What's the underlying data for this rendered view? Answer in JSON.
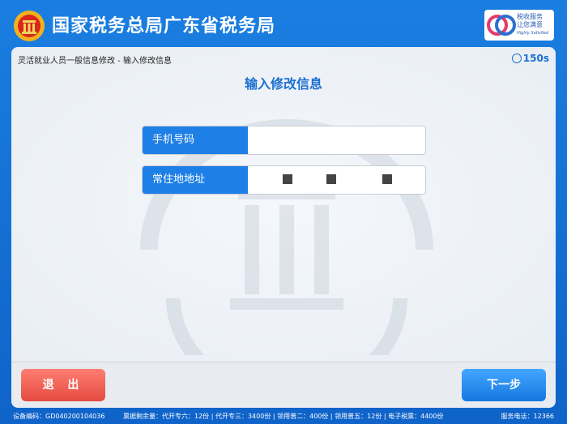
{
  "header": {
    "org_title": "国家税务总局广东省税务局",
    "slogan_logo_line1": "税收服务",
    "slogan_logo_line2": "让您满意",
    "slogan_logo_en": "Highly Satisfied"
  },
  "panel": {
    "breadcrumb": "灵活就业人员一般信息修改  -  输入修改信息",
    "timer": "150s",
    "title": "输入修改信息"
  },
  "form": {
    "phone_label": "手机号码",
    "phone_value": "",
    "address_label": "常住地地址"
  },
  "footer": {
    "exit_label": "退 出",
    "next_label": "下一步"
  },
  "status": {
    "device": "设备编码：GD040200104036",
    "quota": "票据剩余量：代开专六：12份  |  代开专三：3400份  |  领用普二：400份  |  领用普五：12份  |  电子税票：4400份",
    "phone": "服务电话：12366"
  },
  "colors": {
    "brand_blue": "#1a7ee0",
    "label_blue": "#1e7fe6",
    "exit_red": "#e54b3f",
    "title_blue": "#1a6fd1"
  }
}
